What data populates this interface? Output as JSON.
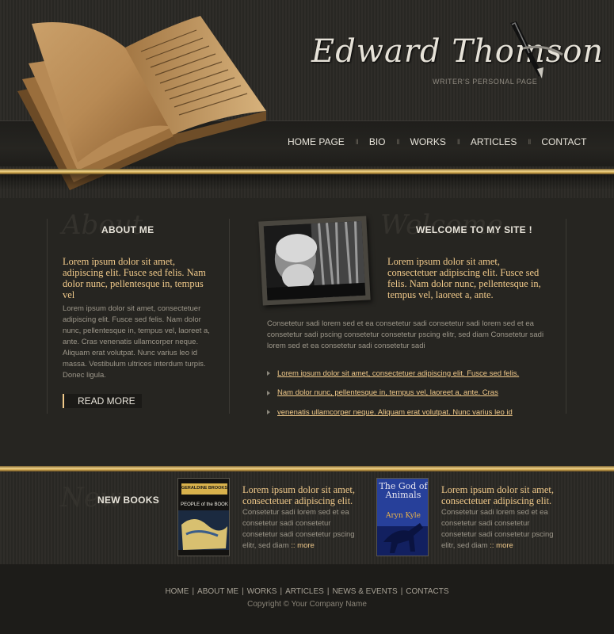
{
  "logo": {
    "name": "Edward Thomson",
    "tagline": "WRITER'S PERSONAL PAGE"
  },
  "nav": {
    "items": [
      "HOME PAGE",
      "BIO",
      "WORKS",
      "ARTICLES",
      "CONTACT"
    ],
    "separator": "II"
  },
  "about": {
    "script_bg": "About",
    "title": "ABOUT ME",
    "lead": "Lorem ipsum dolor sit amet, adipiscing elit. Fusce sed felis. Nam dolor nunc, pellentesque in, tempus vel",
    "body": "Lorem ipsum dolor sit amet, consectetuer adipiscing elit. Fusce sed felis. Nam dolor nunc, pellentesque in, tempus vel, laoreet a, ante. Cras venenatis ullamcorper neque. Aliquam erat volutpat. Nunc varius leo id massa. Vestibulum ultrices interdum turpis. Donec ligula.",
    "read_more": "READ MORE"
  },
  "welcome": {
    "script_bg": "Welcome",
    "title": "WELCOME TO MY SITE !",
    "lead": "Lorem ipsum dolor sit amet, consectetuer adipiscing elit. Fusce sed felis. Nam dolor nunc, pellentesque in, tempus vel, laoreet a, ante.",
    "body": "Consetetur sadi lorem sed  et ea consetetur sadi consetetur sadi lorem sed  et ea consetetur sadi pscing  consetetur consetetur pscing elitr, sed diam Consetetur sadi lorem sed  et ea consetetur sadi consetetur sadi",
    "links": [
      "Lorem ipsum dolor sit amet, consectetuer adipiscing elit. Fusce sed felis.",
      "Nam dolor nunc, pellentesque in, tempus vel, laoreet a, ante. Cras",
      "venenatis ullamcorper neque. Aliquam erat volutpat. Nunc varius leo id"
    ]
  },
  "new_books": {
    "script_bg": "New",
    "title": "NEW BOOKS",
    "books": [
      {
        "cover_author": "GERALDINE BROOKS",
        "cover_title": "PEOPLE of the BOOK",
        "title": "Lorem ipsum dolor sit amet, consectetuer adipiscing elit.",
        "desc": "Consetetur sadi lorem sed  et ea consetetur sadi consetetur consetetur sadi consetetur pscing elitr, sed diam",
        "more": ":: more"
      },
      {
        "cover_title": "The God of Animals",
        "cover_author": "Aryn Kyle",
        "title": "Lorem ipsum dolor sit amet, consectetuer adipiscing elit.",
        "desc": "Consetetur sadi lorem sed  et ea consetetur sadi consetetur consetetur sadi consetetur pscing elitr, sed diam",
        "more": ":: more"
      }
    ]
  },
  "footer": {
    "links": [
      "HOME",
      "ABOUT ME",
      "WORKS",
      "ARTICLES",
      "NEWS & EVENTS",
      "CONTACTS"
    ],
    "separator": "|",
    "copyright": "Copyright © Your Company Name"
  },
  "colors": {
    "accent": "#f0c98a",
    "background": "#262521",
    "gold_line": "#e6c77a"
  }
}
